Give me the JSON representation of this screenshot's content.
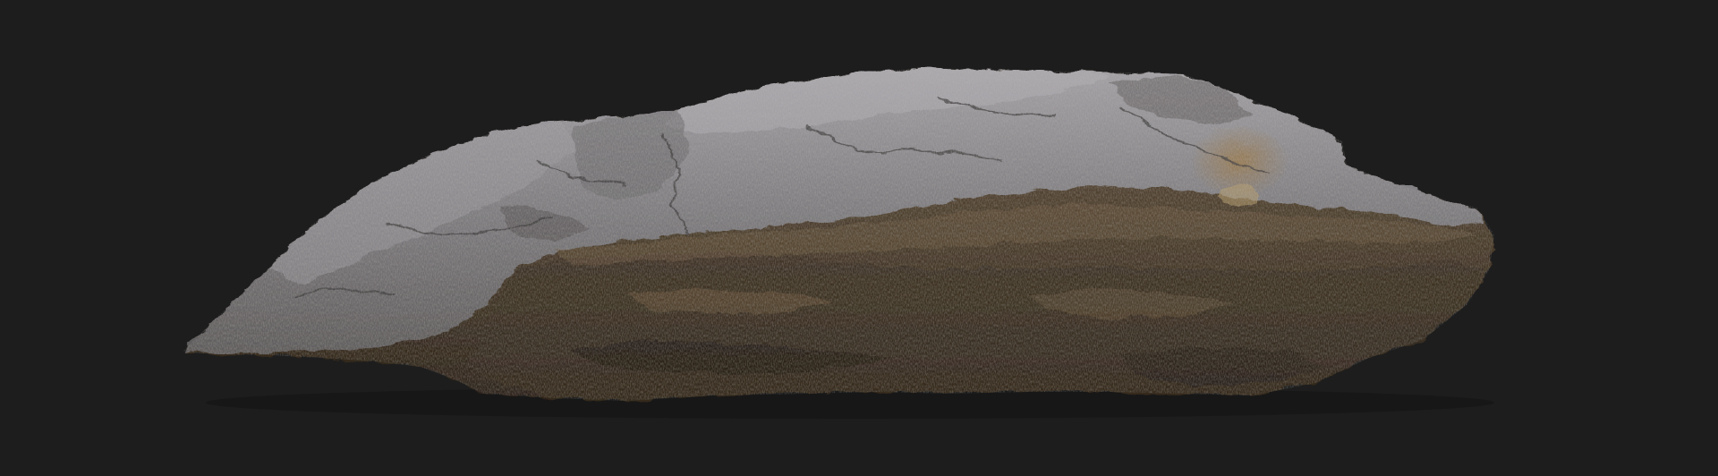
{
  "scene": {
    "subject": "rock",
    "colors": {
      "background": "#1d1d1d",
      "top_surface": "#7c7a7c",
      "top_highlight": "#a9a7ab",
      "side_face": "#5a4a36",
      "side_dark": "#2e251b",
      "ochre_accent": "#8a6a3e"
    }
  }
}
